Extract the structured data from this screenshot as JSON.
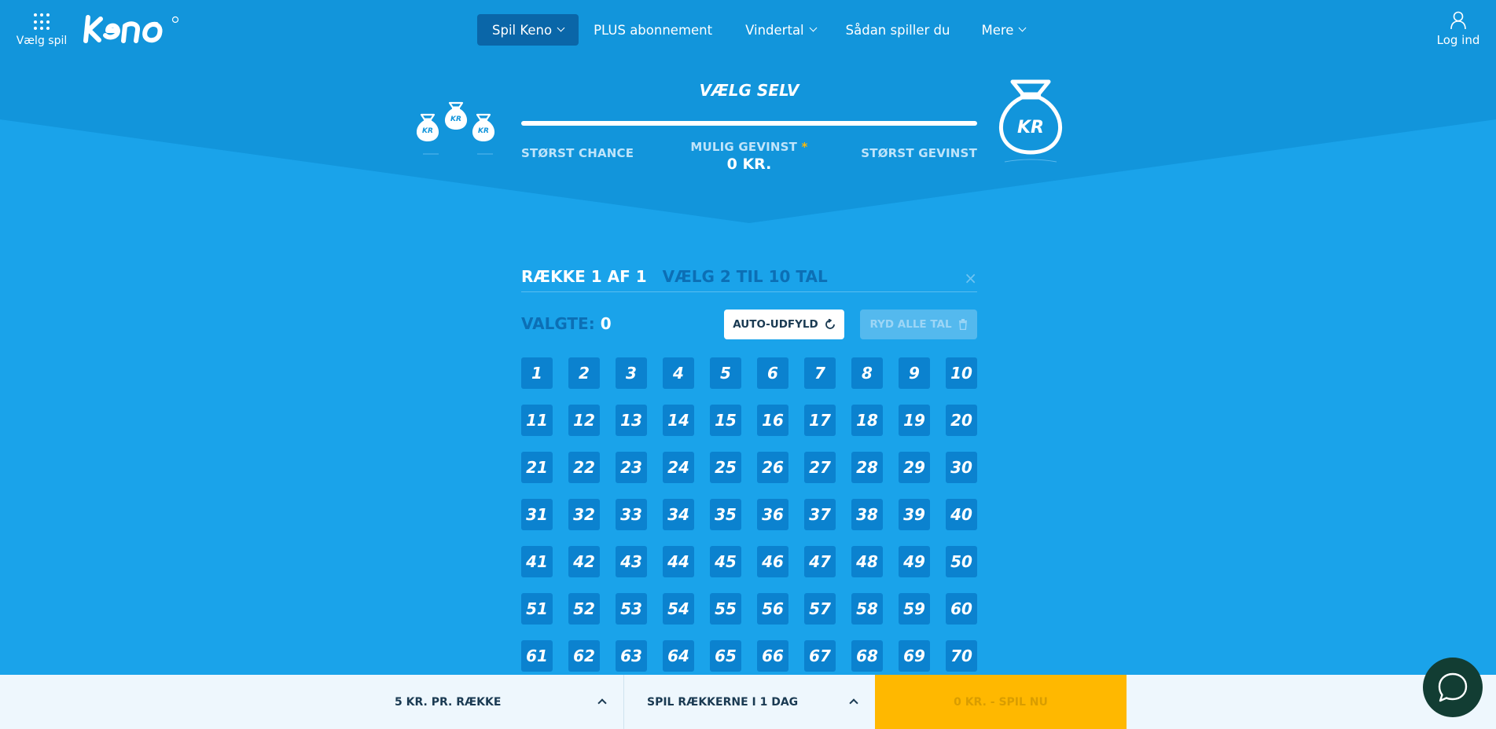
{
  "header": {
    "menu_label": "Vælg spil",
    "nav": [
      {
        "label": "Spil Keno",
        "dropdown": true,
        "active": true
      },
      {
        "label": "PLUS abonnement",
        "dropdown": false
      },
      {
        "label": "Vindertal",
        "dropdown": true
      },
      {
        "label": "Sådan spiller du",
        "dropdown": false
      },
      {
        "label": "Mere",
        "dropdown": true
      }
    ],
    "login_label": "Log ind"
  },
  "hero": {
    "title": "VÆLG SELV",
    "left_label": "STØRST CHANCE",
    "mid_label": "MULIG GEVINST",
    "mid_star": "*",
    "win_value": "0 KR.",
    "right_label": "STØRST GEVINST",
    "bag_text": "KR"
  },
  "row": {
    "title": "RÆKKE 1 AF 1",
    "subtitle": "VÆLG 2 TIL 10 TAL",
    "close": "×",
    "selected_label": "VALGTE:",
    "selected_count": "0",
    "auto_label": "AUTO-UDFYLD",
    "clear_label": "RYD ALLE TAL"
  },
  "numbers": [
    1,
    2,
    3,
    4,
    5,
    6,
    7,
    8,
    9,
    10,
    11,
    12,
    13,
    14,
    15,
    16,
    17,
    18,
    19,
    20,
    21,
    22,
    23,
    24,
    25,
    26,
    27,
    28,
    29,
    30,
    31,
    32,
    33,
    34,
    35,
    36,
    37,
    38,
    39,
    40,
    41,
    42,
    43,
    44,
    45,
    46,
    47,
    48,
    49,
    50,
    51,
    52,
    53,
    54,
    55,
    56,
    57,
    58,
    59,
    60,
    61,
    62,
    63,
    64,
    65,
    66,
    67,
    68,
    69,
    70
  ],
  "bottom": {
    "price_label": "5 KR. PR. RÆKKE",
    "days_label": "SPIL RÆKKERNE I 1 DAG",
    "play_label": "0 KR. - SPIL NU"
  },
  "colors": {
    "background": "#1aa3ea",
    "header": "#1295db",
    "active_nav": "#0a66a8",
    "number_cell": "#0b82cf",
    "play_button": "#ffb800",
    "chat": "#123d33"
  }
}
